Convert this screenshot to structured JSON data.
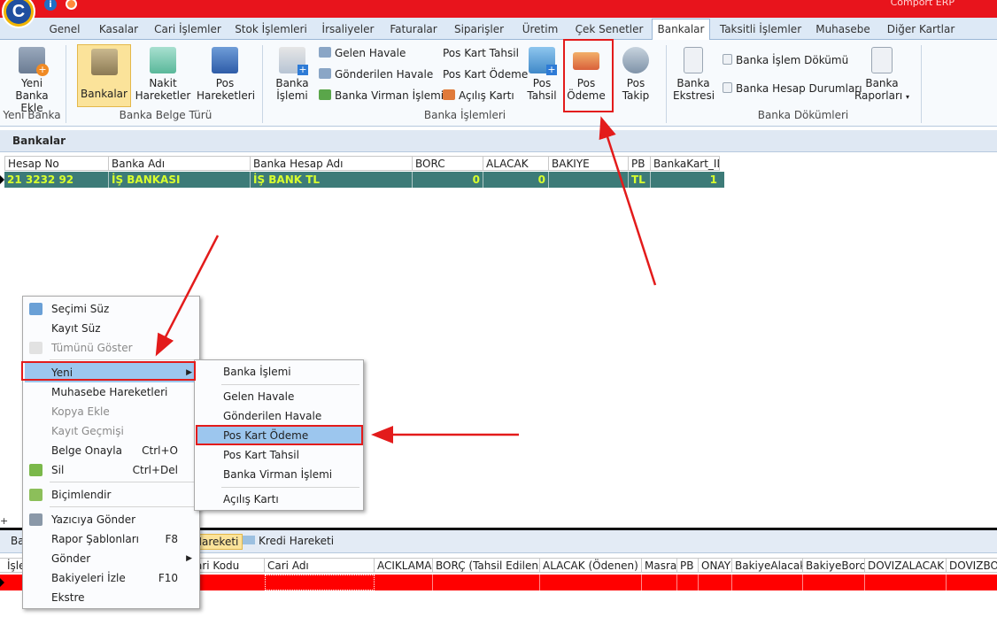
{
  "app": {
    "title": "Comport ERP",
    "logo_letter": "C"
  },
  "colors": {
    "accent": "#e8141c",
    "selected_row": "#3d7b78",
    "selected_text": "#d8ff2e",
    "highlight": "#e31b1b"
  },
  "tabs": [
    "Genel",
    "Kasalar",
    "Cari İşlemler",
    "Stok İşlemleri",
    "İrsaliyeler",
    "Faturalar",
    "Siparişler",
    "Üretim",
    "Çek Senetler",
    "Bankalar",
    "Taksitli İşlemler",
    "Muhasebe",
    "Diğer Kartlar"
  ],
  "active_tab": "Bankalar",
  "ribbon": {
    "yeni_banka": {
      "label1": "Yeni",
      "label2": "Banka Ekle",
      "group": "Yeni Banka"
    },
    "bankalar": "Bankalar",
    "nakit": {
      "label1": "Nakit",
      "label2": "Hareketler"
    },
    "pos_hareketleri": {
      "label1": "Pos",
      "label2": "Hareketleri"
    },
    "belge_group": "Banka Belge Türü",
    "banka_islemi": {
      "label1": "Banka",
      "label2": "İşlemi"
    },
    "gelen_havale": "Gelen Havale",
    "gonderilen_havale": "Gönderilen Havale",
    "banka_virman": "Banka Virman İşlemi",
    "pos_kart_tahsil": "Pos Kart Tahsil",
    "pos_kart_odeme": "Pos Kart Ödeme",
    "acilis_karti": "Açılış Kartı",
    "pos_tahsil": {
      "label1": "Pos",
      "label2": "Tahsil"
    },
    "pos_odeme": {
      "label1": "Pos",
      "label2": "Ödeme"
    },
    "pos_takip": {
      "label1": "Pos",
      "label2": "Takip"
    },
    "islemler_group": "Banka İşlemleri",
    "banka_ekstresi": {
      "label1": "Banka",
      "label2": "Ekstresi"
    },
    "islem_dokumu": "Banka İşlem Dökümü",
    "hesap_durumlari": "Banka Hesap Durumları",
    "banka_raporlari": {
      "label1": "Banka",
      "label2": "Raporları"
    },
    "dokumler_group": "Banka Dökümleri"
  },
  "section_title": "Bankalar",
  "grid": {
    "columns": [
      "Hesap No",
      "Banka Adı",
      "Banka Hesap Adı",
      "BORC",
      "ALACAK",
      "BAKIYE",
      "PB",
      "BankaKart_ID"
    ],
    "rows": [
      {
        "hesap_no": "21 3232 92",
        "banka_adi": "İŞ BANKASI",
        "hesap_adi": "İŞ BANK TL",
        "borc": "0",
        "alacak": "0",
        "bakiye": "",
        "pb": "TL",
        "id": "1"
      }
    ]
  },
  "context_menu": {
    "items": [
      {
        "label": "Seçimi Süz",
        "shortcut": "",
        "icon": "filter-icon",
        "disabled": false
      },
      {
        "label": "Kayıt Süz",
        "shortcut": "",
        "icon": "",
        "disabled": false
      },
      {
        "label": "Tümünü Göster",
        "shortcut": "",
        "icon": "eraser-icon",
        "disabled": true
      },
      {
        "label": "Yeni",
        "shortcut": "",
        "icon": "",
        "disabled": false
      },
      {
        "label": "Muhasebe Hareketleri",
        "shortcut": "",
        "icon": "",
        "disabled": false
      },
      {
        "label": "Kopya Ekle",
        "shortcut": "",
        "icon": "",
        "disabled": true
      },
      {
        "label": "Kayıt Geçmişi",
        "shortcut": "",
        "icon": "",
        "disabled": true
      },
      {
        "label": "Belge Onayla",
        "shortcut": "Ctrl+O",
        "icon": "",
        "disabled": false
      },
      {
        "label": "Sil",
        "shortcut": "Ctrl+Del",
        "icon": "delete-icon",
        "disabled": false
      },
      {
        "label": "Biçimlendir",
        "shortcut": "",
        "icon": "format-icon",
        "disabled": false
      },
      {
        "label": "Yazıcıya Gönder",
        "shortcut": "",
        "icon": "printer-icon",
        "disabled": false
      },
      {
        "label": "Rapor Şablonları",
        "shortcut": "F8",
        "icon": "",
        "disabled": false
      },
      {
        "label": "Gönder",
        "shortcut": "",
        "icon": "",
        "disabled": false
      },
      {
        "label": "Bakiyeleri İzle",
        "shortcut": "F10",
        "icon": "",
        "disabled": false
      },
      {
        "label": "Ekstre",
        "shortcut": "",
        "icon": "",
        "disabled": false
      }
    ]
  },
  "submenu": {
    "items": [
      "Banka İşlemi",
      "Gelen Havale",
      "Gönderilen Havale",
      "Pos Kart Ödeme",
      "Pos Kart Tahsil",
      "Banka Virman İşlemi",
      "Açılış Kartı"
    ]
  },
  "bottom": {
    "tab_partial": "Ba",
    "tab_hareketi": "Hareketi",
    "tab_kredi": "Kredi Hareketi",
    "columns": [
      "İşle",
      "ari Kodu",
      "Cari Adı",
      "ACIKLAMA",
      "BORÇ (Tahsil Edilen)",
      "ALACAK (Ödenen)",
      "Masraf",
      "PB",
      "ONAY",
      "BakiyeAlacak",
      "BakiyeBorc",
      "DOVIZALACAK",
      "DOVIZBO"
    ]
  },
  "icons": {
    "logo": "app-logo-icon",
    "info": "info-icon",
    "help": "help-icon"
  }
}
